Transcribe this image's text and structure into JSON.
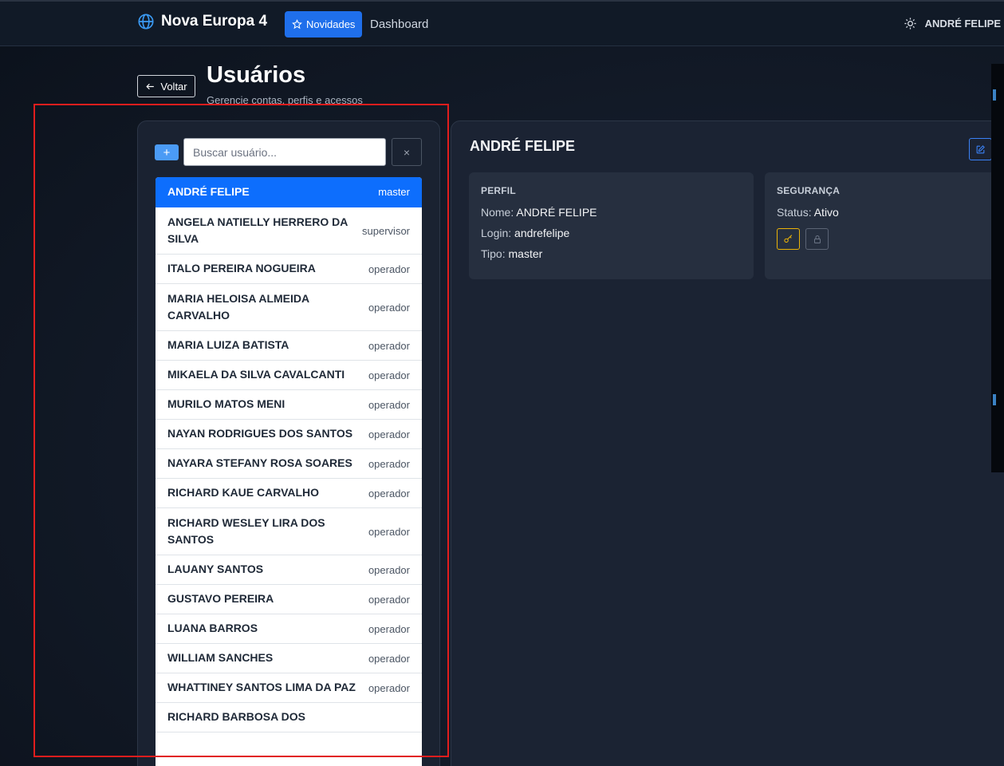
{
  "topbar": {
    "brand_icon": "globe-icon",
    "brand_title": "Nova Europa 4",
    "novidades_label": "Novidades",
    "dashboard_label": "Dashboard",
    "theme_icon": "sun-icon",
    "current_user": "ANDRÉ FELIPE"
  },
  "header": {
    "back_label": "Voltar",
    "title": "Usuários",
    "subtitle": "Gerencie contas, perfis e acessos"
  },
  "sidebar": {
    "add_label": "+",
    "search_placeholder": "Buscar usuário...",
    "clear_label": "×",
    "users": [
      {
        "name": "ANDRÉ FELIPE",
        "role": "master",
        "active": true
      },
      {
        "name": "ANGELA NATIELLY HERRERO DA SILVA",
        "role": "supervisor"
      },
      {
        "name": "ITALO PEREIRA NOGUEIRA",
        "role": "operador"
      },
      {
        "name": "MARIA HELOISA ALMEIDA CARVALHO",
        "role": "operador"
      },
      {
        "name": "MARIA LUIZA BATISTA",
        "role": "operador"
      },
      {
        "name": "MIKAELA DA SILVA CAVALCANTI",
        "role": "operador"
      },
      {
        "name": "MURILO MATOS MENI",
        "role": "operador"
      },
      {
        "name": "NAYAN RODRIGUES DOS SANTOS",
        "role": "operador"
      },
      {
        "name": "NAYARA STEFANY ROSA SOARES",
        "role": "operador"
      },
      {
        "name": "RICHARD KAUE CARVALHO",
        "role": "operador"
      },
      {
        "name": "RICHARD WESLEY LIRA DOS SANTOS",
        "role": "operador"
      },
      {
        "name": "LAUANY SANTOS",
        "role": "operador"
      },
      {
        "name": "GUSTAVO PEREIRA",
        "role": "operador"
      },
      {
        "name": "LUANA BARROS",
        "role": "operador"
      },
      {
        "name": "WILLIAM SANCHES",
        "role": "operador"
      },
      {
        "name": "WHATTINEY SANTOS LIMA DA PAZ",
        "role": "operador"
      },
      {
        "name": "RICHARD BARBOSA DOS",
        "role": ""
      }
    ]
  },
  "detail": {
    "title": "ANDRÉ FELIPE",
    "edit_icon": "edit-icon",
    "profile": {
      "heading": "PERFIL",
      "name_label": "Nome:",
      "name_value": "ANDRÉ FELIPE",
      "login_label": "Login:",
      "login_value": "andrefelipe",
      "type_label": "Tipo:",
      "type_value": "master"
    },
    "security": {
      "heading": "SEGURANÇA",
      "status_label": "Status:",
      "status_value": "Ativo",
      "key_icon": "key-icon",
      "lock_icon": "lock-icon"
    }
  },
  "colors": {
    "accent": "#0d6efd",
    "highlight": "#e11d1d",
    "key_border": "#eab308"
  }
}
